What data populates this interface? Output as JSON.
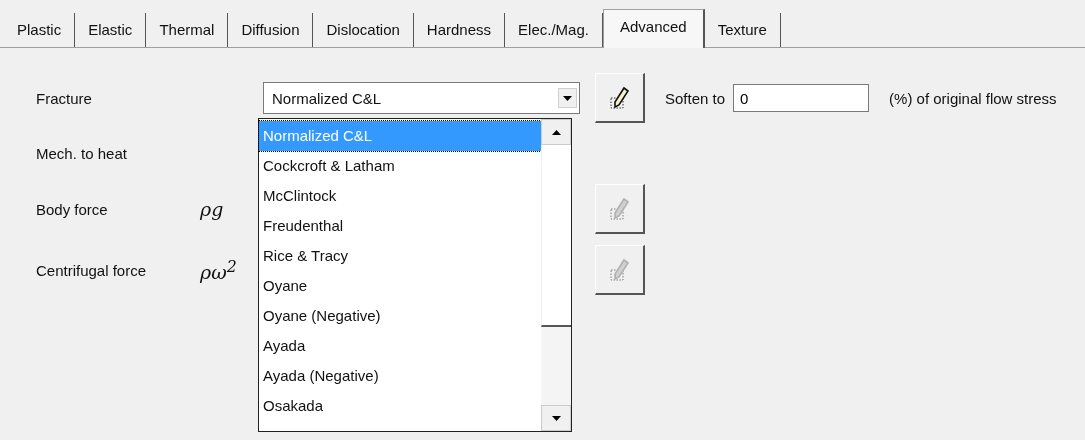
{
  "tabs": [
    {
      "label": "Plastic",
      "selected": false
    },
    {
      "label": "Elastic",
      "selected": false
    },
    {
      "label": "Thermal",
      "selected": false
    },
    {
      "label": "Diffusion",
      "selected": false
    },
    {
      "label": "Dislocation",
      "selected": false
    },
    {
      "label": "Hardness",
      "selected": false
    },
    {
      "label": "Elec./Mag.",
      "selected": false
    },
    {
      "label": "Advanced",
      "selected": true
    },
    {
      "label": "Texture",
      "selected": false
    }
  ],
  "fracture": {
    "label": "Fracture",
    "value": "Normalized C&L",
    "edit_disabled": false,
    "soften_label": "Soften to",
    "soften_value": "0",
    "suffix": "(%) of original flow stress"
  },
  "rows": [
    {
      "label": "Mech. to heat"
    },
    {
      "label": "Body force",
      "formula": "ρg",
      "edit_disabled": true
    },
    {
      "label": "Centrifugal force",
      "formula": "ρω$^{2}$",
      "edit_disabled": true
    }
  ],
  "dropdown": {
    "items": [
      {
        "label": "Normalized C&L",
        "selected": true
      },
      {
        "label": "Cockcroft & Latham",
        "selected": false
      },
      {
        "label": "McClintock",
        "selected": false
      },
      {
        "label": "Freudenthal",
        "selected": false
      },
      {
        "label": "Rice & Tracy",
        "selected": false
      },
      {
        "label": "Oyane",
        "selected": false
      },
      {
        "label": "Oyane (Negative)",
        "selected": false
      },
      {
        "label": "Ayada",
        "selected": false
      },
      {
        "label": "Ayada (Negative)",
        "selected": false
      },
      {
        "label": "Osakada",
        "selected": false
      }
    ]
  }
}
